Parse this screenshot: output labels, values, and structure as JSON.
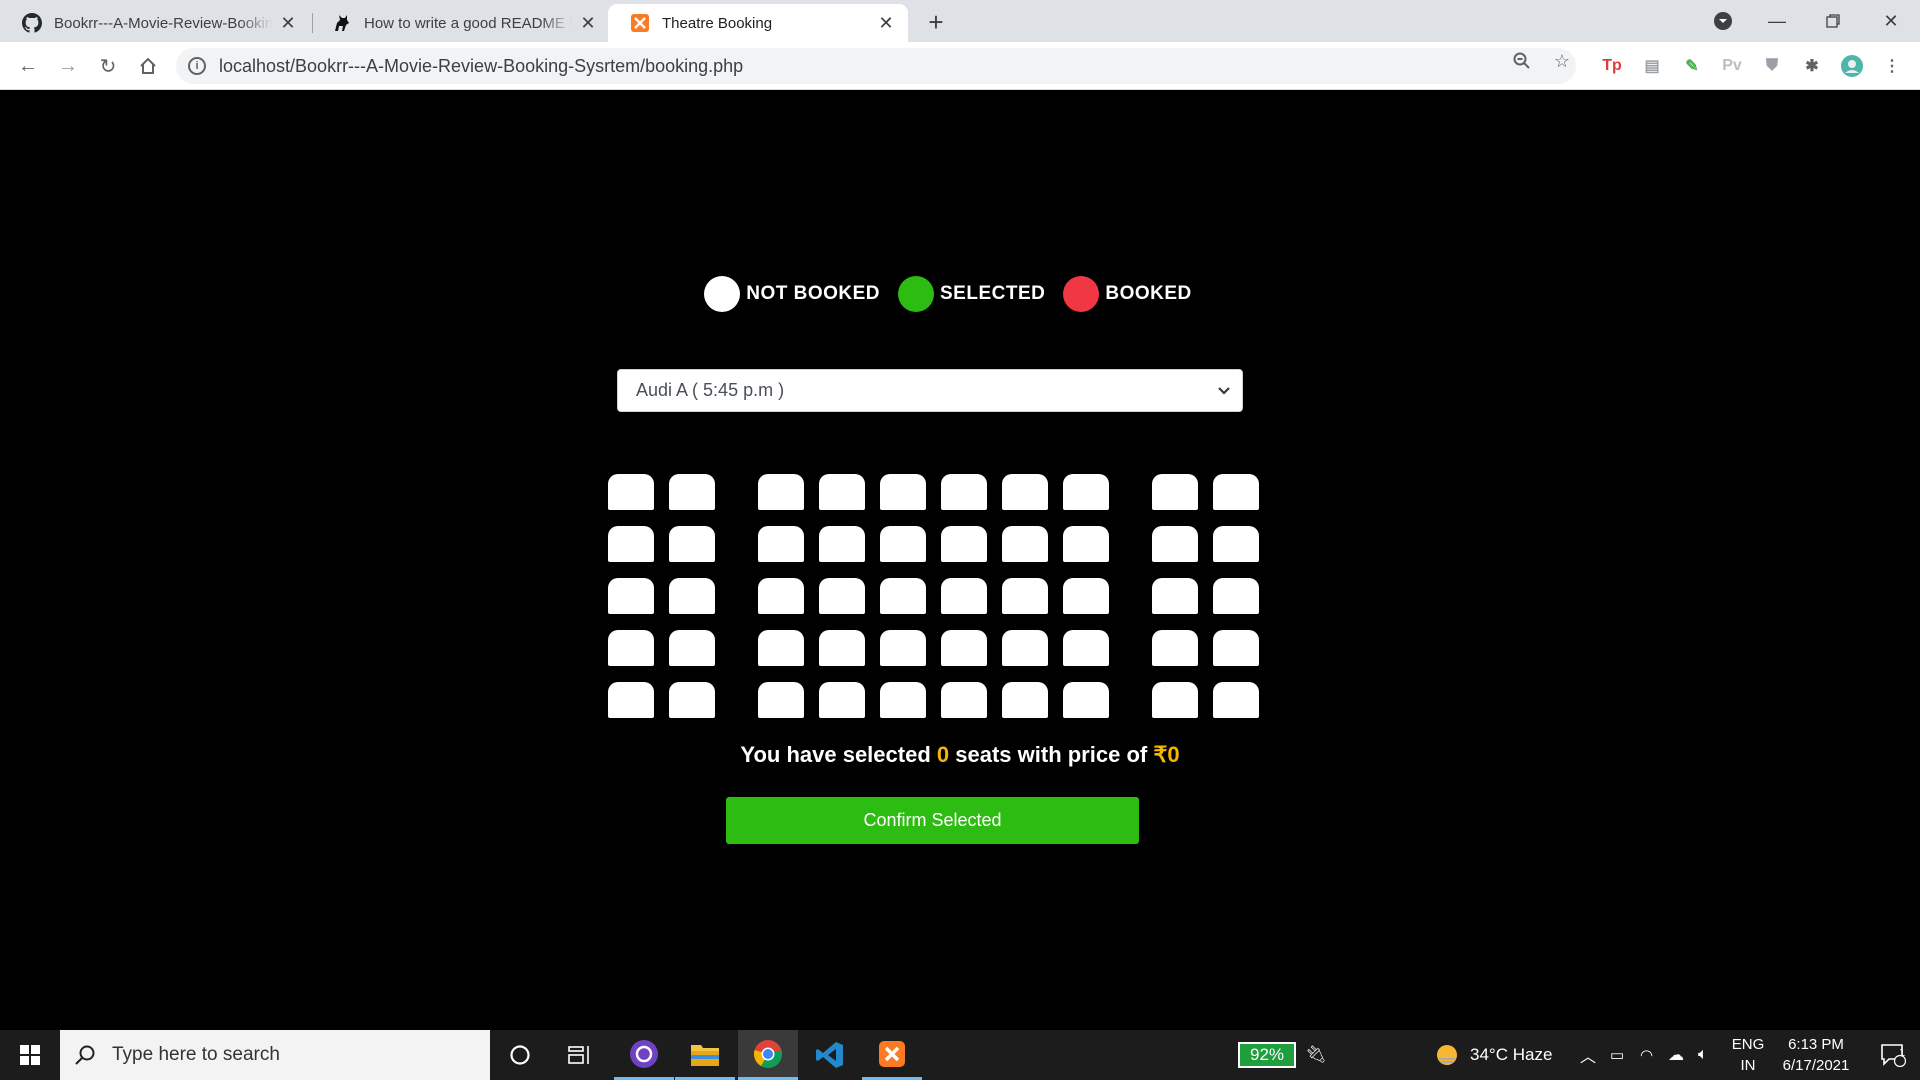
{
  "browser": {
    "tabs": [
      {
        "title": "Bookrr---A-Movie-Review-Booking-Sysrtem",
        "icon": "github-icon"
      },
      {
        "title": "How to write a good README for your GitHub project",
        "icon": "cat-icon"
      },
      {
        "title": "Theatre Booking",
        "icon": "xampp-icon"
      }
    ],
    "url": "localhost/Bookrr---A-Movie-Review-Booking-Sysrtem/booking.php"
  },
  "legend": [
    {
      "label": "NOT BOOKED",
      "color": "#ffffff"
    },
    {
      "label": "SELECTED",
      "color": "#2dbc12"
    },
    {
      "label": "BOOKED",
      "color": "#f23744"
    }
  ],
  "show_select": {
    "selected": "Audi A ( 5:45 p.m )"
  },
  "seating": {
    "rows": 5,
    "sections": [
      2,
      6,
      2
    ],
    "seat_color": "#ffffff"
  },
  "summary": {
    "prefix": "You have selected",
    "count": "0",
    "middle": "seats with price of",
    "price": "₹0"
  },
  "confirm_label": "Confirm Selected",
  "taskbar": {
    "search_placeholder": "Type here to search",
    "battery": "92%",
    "weather": "34°C  Haze",
    "lang_1": "ENG",
    "lang_2": "IN",
    "time": "6:13 PM",
    "date": "6/17/2021",
    "notification_count": "1"
  }
}
